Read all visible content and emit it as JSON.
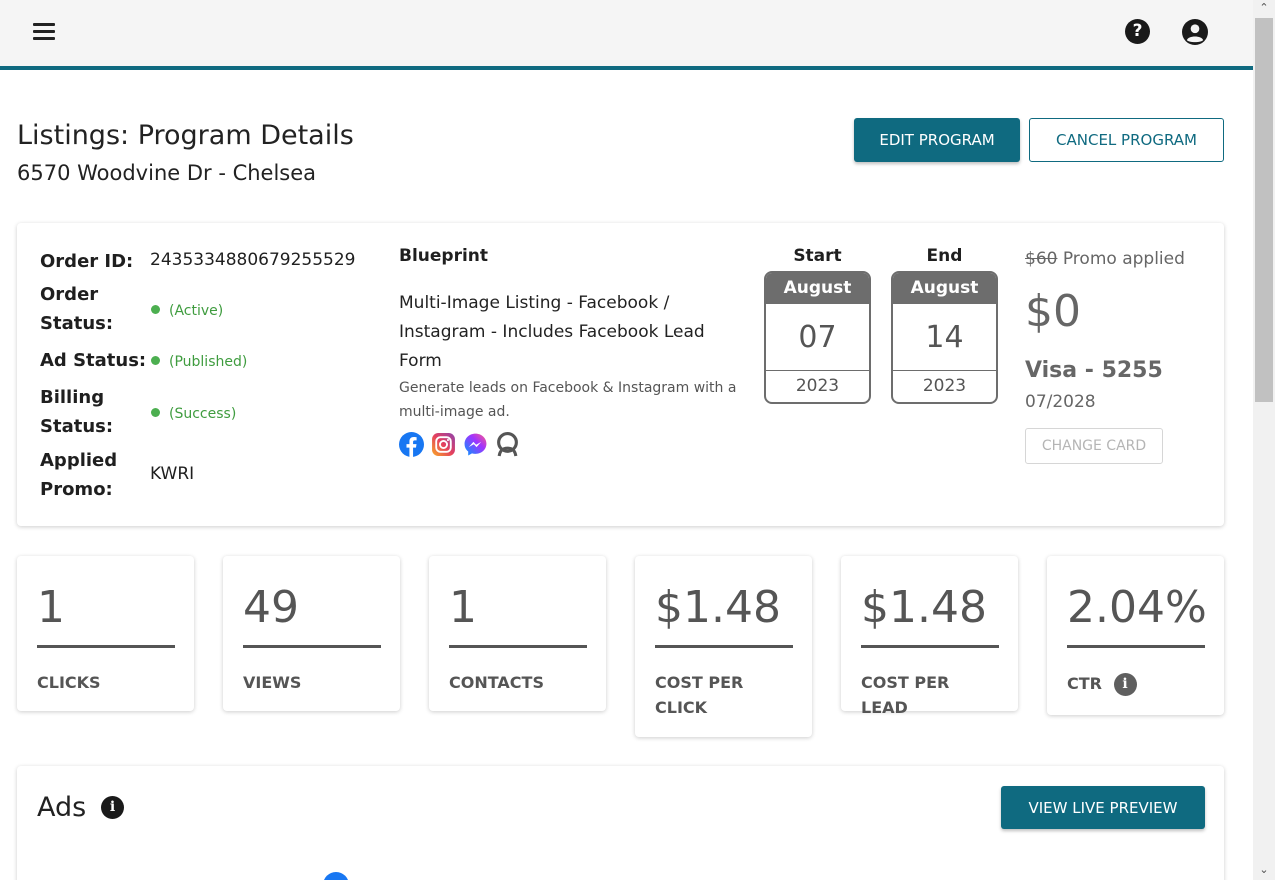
{
  "header": {
    "menu_icon": "hamburger-menu-icon",
    "help_icon": "help-icon",
    "account_icon": "account-circle-icon",
    "accent": "#0f6a80"
  },
  "page": {
    "title": "Listings: Program Details",
    "subtitle": "6570 Woodvine Dr - Chelsea"
  },
  "actions": {
    "edit": "EDIT PROGRAM",
    "cancel": "CANCEL PROGRAM"
  },
  "order": {
    "id_label": "Order ID:",
    "id_value": "2435334880679255529",
    "status_label": "Order Status:",
    "status_value": "(Active)",
    "ad_label": "Ad Status:",
    "ad_value": "(Published)",
    "billing_label": "Billing Status:",
    "billing_value": "(Success)",
    "promo_label": "Applied Promo:",
    "promo_value": "KWRI"
  },
  "blueprint": {
    "heading": "Blueprint",
    "name": "Multi-Image Listing - Facebook / Instagram - Includes Facebook Lead Form",
    "description": "Generate leads on Facebook & Instagram with a multi-image ad.",
    "platforms": [
      "facebook-icon",
      "instagram-icon",
      "messenger-icon",
      "audience-network-icon"
    ]
  },
  "dates": {
    "start": {
      "label": "Start",
      "month": "August",
      "day": "07",
      "year": "2023"
    },
    "end": {
      "label": "End",
      "month": "August",
      "day": "14",
      "year": "2023"
    }
  },
  "billing": {
    "original_price": "$60",
    "promo_text": "Promo applied",
    "price": "$0",
    "card": "Visa - 5255",
    "expiry": "07/2028",
    "change_card": "CHANGE CARD"
  },
  "stats": [
    {
      "value": "1",
      "label": "CLICKS"
    },
    {
      "value": "49",
      "label": "VIEWS"
    },
    {
      "value": "1",
      "label": "CONTACTS"
    },
    {
      "value": "$1.48",
      "label": "COST PER CLICK"
    },
    {
      "value": "$1.48",
      "label": "COST PER LEAD"
    },
    {
      "value": "2.04%",
      "label": "CTR"
    }
  ],
  "ads": {
    "title": "Ads",
    "preview_button": "VIEW LIVE PREVIEW"
  }
}
